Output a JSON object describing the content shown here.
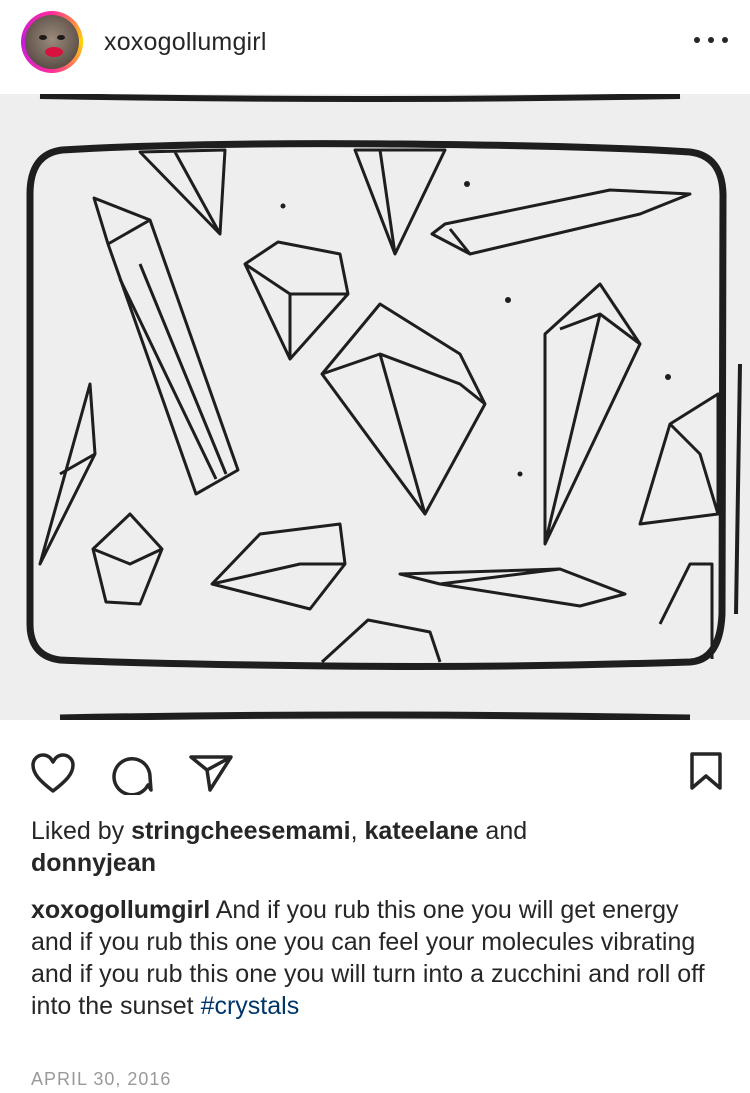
{
  "post": {
    "username": "xoxogollumgirl",
    "more_icon": "more-horizontal-icon"
  },
  "actions": {
    "like_icon": "heart-icon",
    "comment_icon": "comment-icon",
    "share_icon": "send-icon",
    "save_icon": "bookmark-icon"
  },
  "likes": {
    "prefix": "Liked by ",
    "user1": "stringcheesemami",
    "sep": ", ",
    "user2": "kateelane",
    "conj": " and",
    "user3": "donnyjean"
  },
  "caption": {
    "username": "xoxogollumgirl",
    "text": " And if you rub this one you will get energy and if you rub this one you can feel your molecules vibrating and if you rub this one you will turn into a zucchini and roll off into the sunset ",
    "hashtag": "#crystals"
  },
  "date": "APRIL 30, 2016",
  "colors": {
    "text": "#262626",
    "hashtag": "#003569",
    "date": "#999999",
    "avatar_ring": "#ff2d9b"
  }
}
